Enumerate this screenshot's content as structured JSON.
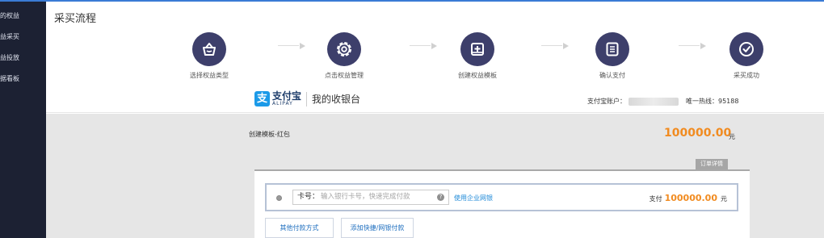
{
  "sidebar": {
    "items": [
      {
        "label": "的权益"
      },
      {
        "label": "益采买"
      },
      {
        "label": "益投放"
      },
      {
        "label": "据看板"
      }
    ]
  },
  "page": {
    "title": "采买流程"
  },
  "steps": [
    {
      "label": "选择权益类型",
      "icon": "basket-icon"
    },
    {
      "label": "点击权益管理",
      "icon": "gear-icon"
    },
    {
      "label": "创建权益模板",
      "icon": "add-template-icon"
    },
    {
      "label": "确认支付",
      "icon": "document-list-icon"
    },
    {
      "label": "采买成功",
      "icon": "check-circle-icon"
    }
  ],
  "alipay": {
    "logo_mark": "支",
    "brand_cn": "支付宝",
    "brand_en": "ALIPAY",
    "cashier": "我的收银台",
    "account_label": "支付宝账户：",
    "hotline": "唯一热线：95188"
  },
  "order": {
    "title": "创建模板-红包",
    "amount": "100000.00",
    "currency": "元",
    "detail_tab": "订单详情"
  },
  "payment": {
    "card_label": "卡号：",
    "card_placeholder": "输入银行卡号，快速完成付款",
    "help_icon": "?",
    "ebank_link": "使用企业网银",
    "pay_label": "支付",
    "pay_amount": "100000.00",
    "pay_currency": "元",
    "other_methods_button": "其他付款方式",
    "add_quick_button": "添加快捷/网银付款"
  },
  "colors": {
    "sidebar_bg": "#1c2133",
    "step_circle": "#3d3f6b",
    "amount_orange": "#f18b20",
    "link_blue": "#1f8ad8",
    "alipay_blue": "#1b9ae8"
  }
}
